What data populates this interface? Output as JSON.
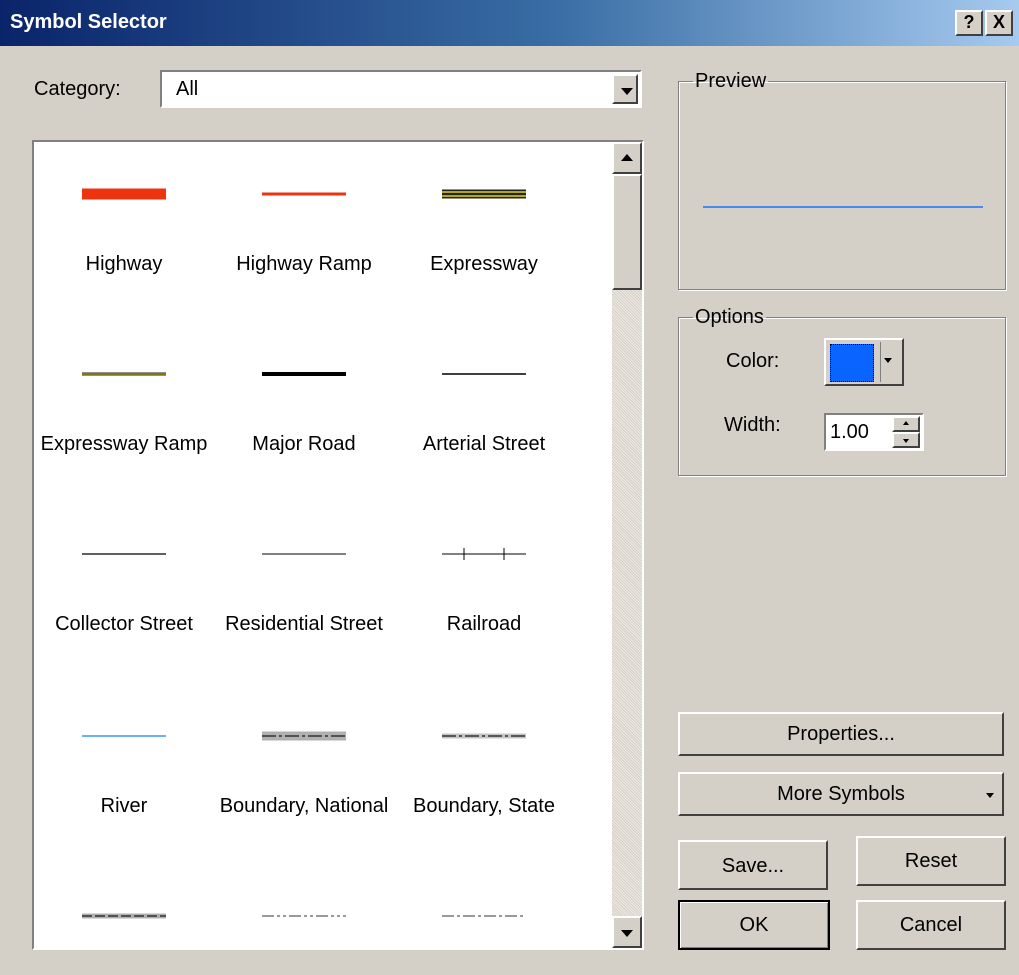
{
  "window": {
    "title": "Symbol Selector",
    "help_label": "?",
    "close_label": "X"
  },
  "category": {
    "label": "Category:",
    "value": "All"
  },
  "symbols": [
    {
      "label": "Highway"
    },
    {
      "label": "Highway Ramp"
    },
    {
      "label": "Expressway"
    },
    {
      "label": "Expressway Ramp"
    },
    {
      "label": "Major Road"
    },
    {
      "label": "Arterial Street"
    },
    {
      "label": "Collector Street"
    },
    {
      "label": "Residential Street"
    },
    {
      "label": "Railroad"
    },
    {
      "label": "River"
    },
    {
      "label": "Boundary, National"
    },
    {
      "label": "Boundary, State"
    },
    {
      "label": ""
    },
    {
      "label": ""
    },
    {
      "label": ""
    }
  ],
  "preview": {
    "legend": "Preview",
    "line_color": "#1a73ff"
  },
  "options": {
    "legend": "Options",
    "color_label": "Color:",
    "color_value": "#0a64ff",
    "width_label": "Width:",
    "width_value": "1.00"
  },
  "buttons": {
    "properties": "Properties...",
    "more_symbols": "More Symbols",
    "save": "Save...",
    "reset": "Reset",
    "ok": "OK",
    "cancel": "Cancel"
  }
}
